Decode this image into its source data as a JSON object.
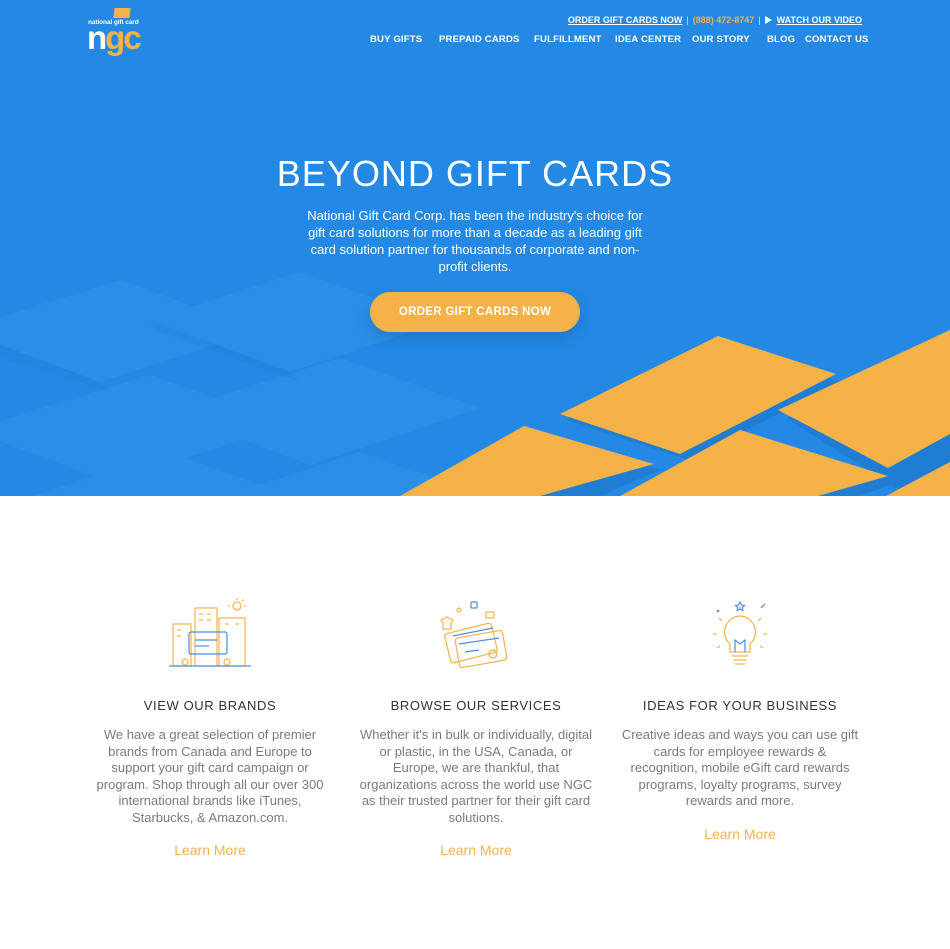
{
  "brand": {
    "logo_small": "national gift card",
    "logo_main_white": "n",
    "logo_main_orange": "gc",
    "colors": {
      "blue": "#2489e4",
      "orange": "#f5b249",
      "text_gray": "#7a7a7a"
    }
  },
  "topbar": {
    "order_link": "ORDER GIFT CARDS NOW",
    "phone": "(888) 472-8747",
    "separator": "|",
    "video_link": "WATCH OUR VIDEO",
    "video_icon": "play-icon"
  },
  "nav": {
    "items": [
      {
        "label": "BUY GIFTS"
      },
      {
        "label": "PREPAID CARDS"
      },
      {
        "label": "FULFILLMENT"
      },
      {
        "label": "IDEA CENTER"
      },
      {
        "label": "OUR STORY"
      },
      {
        "label": "BLOG"
      },
      {
        "label": "CONTACT US"
      }
    ]
  },
  "hero": {
    "title": "BEYOND GIFT CARDS",
    "subtitle": "National Gift Card Corp. has been the industry's choice for gift card solutions for more than a decade as a leading gift card solution partner for thousands of corporate and non-profit clients.",
    "cta": "ORDER GIFT CARDS NOW"
  },
  "features": [
    {
      "icon": "storefront-icon",
      "title": "VIEW OUR BRANDS",
      "text": "We have a great selection of premier brands from Canada and Europe to support your gift card campaign or program. Shop through all our over 300 international brands like iTunes, Starbucks, & Amazon.com.",
      "link": "Learn More"
    },
    {
      "icon": "gift-cards-icon",
      "title": "BROWSE OUR SERVICES",
      "text": "Whether it's in bulk or individually, digital or plastic, in the USA, Canada, or Europe, we are thankful, that organizations across the world use NGC as their trusted partner for their gift card solutions.",
      "link": "Learn More"
    },
    {
      "icon": "lightbulb-icon",
      "title": "IDEAS FOR YOUR BUSINESS",
      "text": "Creative ideas and ways you can use gift cards for employee rewards & recognition, mobile eGift card rewards programs, loyalty programs, survey rewards and more.",
      "link": "Learn More"
    }
  ]
}
